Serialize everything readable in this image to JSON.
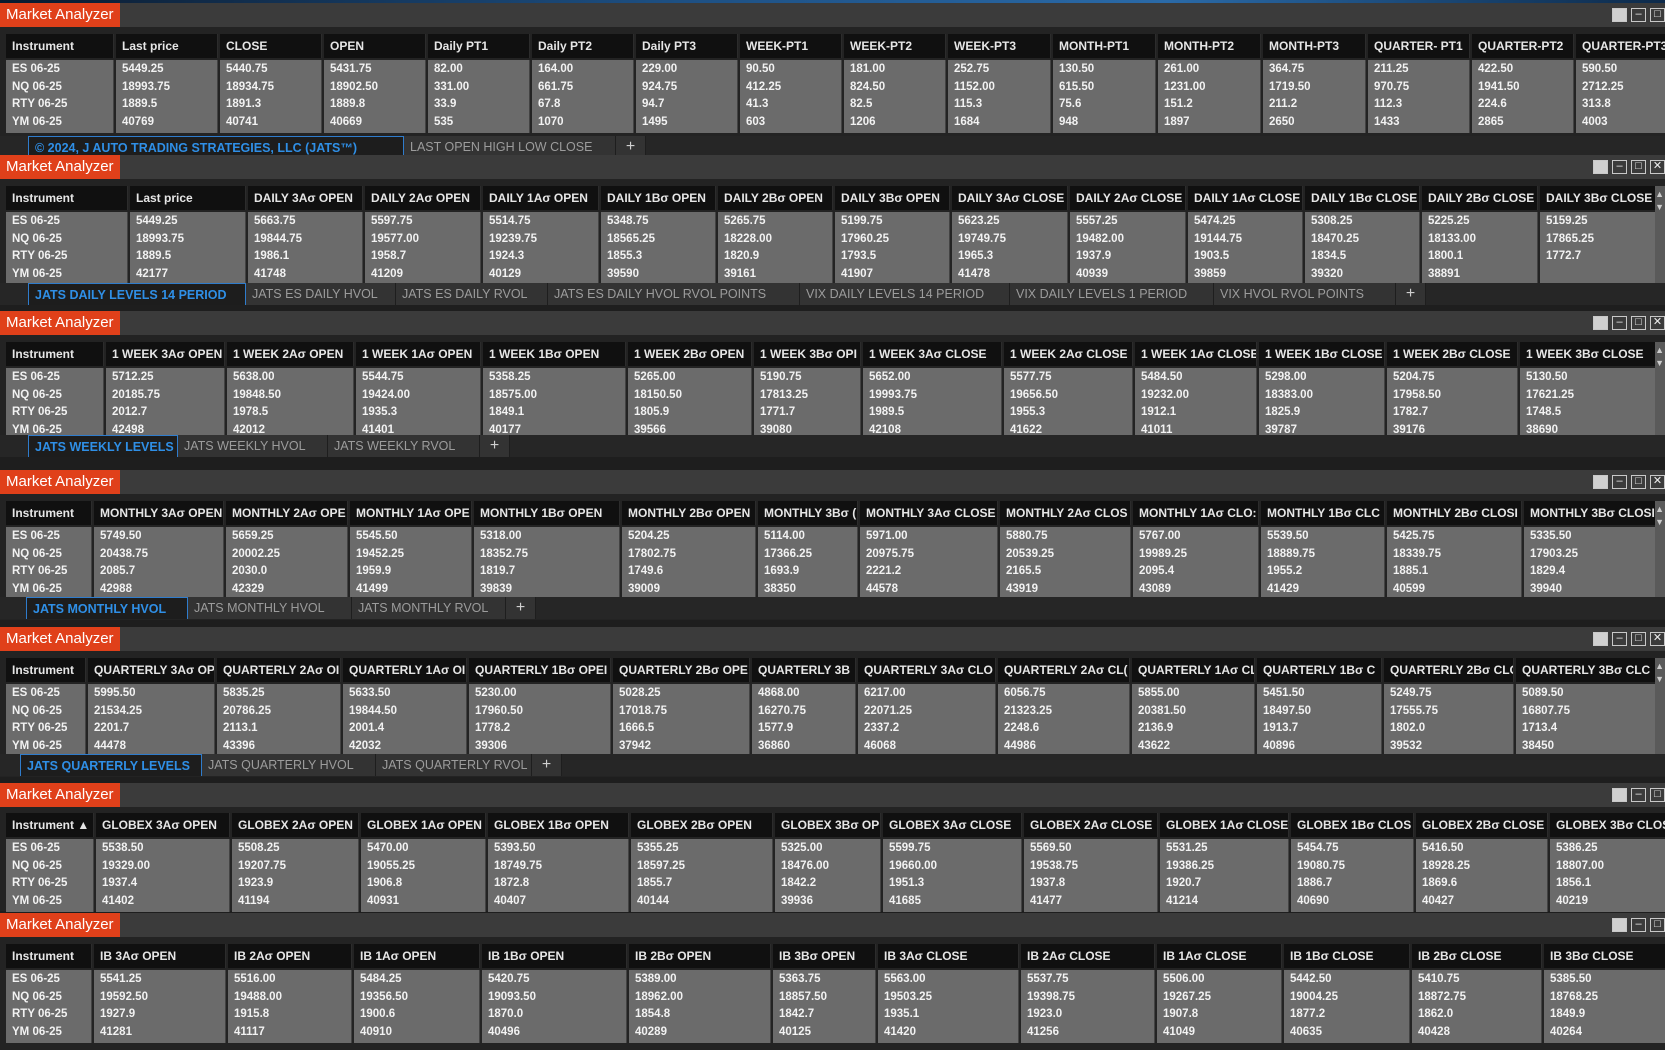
{
  "instruments": [
    "ES 06-25",
    "NQ 06-25",
    "RTY 06-25",
    "YM 06-25"
  ],
  "panels": [
    {
      "title": "Market Analyzer",
      "columns": [
        "Instrument",
        "Last price",
        "CLOSE",
        "OPEN",
        "Daily PT1",
        "Daily PT2",
        "Daily PT3",
        "WEEK-PT1",
        "WEEK-PT2",
        "WEEK-PT3",
        "MONTH-PT1",
        "MONTH-PT2",
        "MONTH-PT3",
        "QUARTER- PT1",
        "QUARTER-PT2",
        "QUARTER-PT3"
      ],
      "rows": [
        [
          "ES 06-25",
          "5449.25",
          "5440.75",
          "5431.75",
          "82.00",
          "164.00",
          "229.00",
          "90.50",
          "181.00",
          "252.75",
          "130.50",
          "261.00",
          "364.75",
          "211.25",
          "422.50",
          "590.50"
        ],
        [
          "NQ 06-25",
          "18993.75",
          "18934.75",
          "18902.50",
          "331.00",
          "661.75",
          "924.75",
          "412.25",
          "824.50",
          "1152.00",
          "615.50",
          "1231.00",
          "1719.50",
          "970.75",
          "1941.50",
          "2712.25"
        ],
        [
          "RTY 06-25",
          "1889.5",
          "1891.3",
          "1889.8",
          "33.9",
          "67.8",
          "94.7",
          "41.3",
          "82.5",
          "115.3",
          "75.6",
          "151.2",
          "211.2",
          "112.3",
          "224.6",
          "313.8"
        ],
        [
          "YM 06-25",
          "40769",
          "40741",
          "40669",
          "535",
          "1070",
          "1495",
          "603",
          "1206",
          "1684",
          "948",
          "1897",
          "2650",
          "1433",
          "2865",
          "4003"
        ]
      ],
      "tabs": [
        "© 2024, J AUTO TRADING STRATEGIES, LLC (JATS™)",
        "LAST OPEN HIGH LOW CLOSE",
        "+"
      ]
    },
    {
      "title": "Market Analyzer",
      "columns": [
        "Instrument",
        "Last price",
        "DAILY 3Aσ OPEN",
        "DAILY 2Aσ OPEN",
        "DAILY 1Aσ OPEN",
        "DAILY 1Bσ OPEN",
        "DAILY 2Bσ OPEN",
        "DAILY 3Bσ OPEN",
        "DAILY 3Aσ CLOSE",
        "DAILY 2Aσ CLOSE",
        "DAILY 1Aσ CLOSE",
        "DAILY 1Bσ CLOSE",
        "DAILY 2Bσ CLOSE",
        "DAILY 3Bσ CLOSE"
      ],
      "rows": [
        [
          "ES 06-25",
          "5449.25",
          "5663.75",
          "5597.75",
          "5514.75",
          "5348.75",
          "5265.75",
          "5199.75",
          "5623.25",
          "5557.25",
          "5474.25",
          "5308.25",
          "5225.25",
          "5159.25"
        ],
        [
          "NQ 06-25",
          "18993.75",
          "19844.75",
          "19577.00",
          "19239.75",
          "18565.25",
          "18228.00",
          "17960.25",
          "19749.75",
          "19482.00",
          "19144.75",
          "18470.25",
          "18133.00",
          "17865.25"
        ],
        [
          "RTY 06-25",
          "1889.5",
          "1986.1",
          "1958.7",
          "1924.3",
          "1855.3",
          "1820.9",
          "1793.5",
          "1965.3",
          "1937.9",
          "1903.5",
          "1834.5",
          "1800.1",
          "1772.7"
        ],
        [
          "YM 06-25",
          "42177",
          "41748",
          "41209",
          "40129",
          "39590",
          "39161",
          "41907",
          "41478",
          "40939",
          "39859",
          "39320",
          "38891"
        ]
      ],
      "tabs": [
        "JATS DAILY LEVELS 14 PERIOD",
        "JATS ES DAILY HVOL",
        "JATS ES DAILY RVOL",
        "JATS ES DAILY HVOL RVOL POINTS",
        "VIX DAILY LEVELS 14 PERIOD",
        "VIX DAILY LEVELS 1 PERIOD",
        "VIX HVOL RVOL POINTS",
        "+"
      ]
    },
    {
      "title": "Market Analyzer",
      "columns": [
        "Instrument",
        "1 WEEK 3Aσ OPEN",
        "1 WEEK 2Aσ OPEN",
        "1 WEEK 1Aσ OPEN",
        "1 WEEK 1Bσ OPEN",
        "1 WEEK 2Bσ OPEN",
        "1 WEEK 3Bσ OPI",
        "1 WEEK 3Aσ CLOSE",
        "1 WEEK 2Aσ CLOSE",
        "1 WEEK 1Aσ CLOSE",
        "1 WEEK 1Bσ CLOSE",
        "1 WEEK 2Bσ CLOSE",
        "1 WEEK 3Bσ CLOSE"
      ],
      "rows": [
        [
          "ES 06-25",
          "5712.25",
          "5638.00",
          "5544.75",
          "5358.25",
          "5265.00",
          "5190.75",
          "5652.00",
          "5577.75",
          "5484.50",
          "5298.00",
          "5204.75",
          "5130.50"
        ],
        [
          "NQ 06-25",
          "20185.75",
          "19848.50",
          "19424.00",
          "18575.00",
          "18150.50",
          "17813.25",
          "19993.75",
          "19656.50",
          "19232.00",
          "18383.00",
          "17958.50",
          "17621.25"
        ],
        [
          "RTY 06-25",
          "2012.7",
          "1978.5",
          "1935.3",
          "1849.1",
          "1805.9",
          "1771.7",
          "1989.5",
          "1955.3",
          "1912.1",
          "1825.9",
          "1782.7",
          "1748.5"
        ],
        [
          "YM 06-25",
          "42498",
          "42012",
          "41401",
          "40177",
          "39566",
          "39080",
          "42108",
          "41622",
          "41011",
          "39787",
          "39176",
          "38690"
        ]
      ],
      "tabs": [
        "JATS WEEKLY LEVELS",
        "JATS WEEKLY HVOL",
        "JATS WEEKLY RVOL",
        "+"
      ]
    },
    {
      "title": "Market Analyzer",
      "columns": [
        "Instrument",
        "MONTHLY 3Aσ OPEN",
        "MONTHLY 2Aσ OPE",
        "MONTHLY 1Aσ OPE",
        "MONTHLY 1Bσ OPEN",
        "MONTHLY 2Bσ OPEN",
        "MONTHLY 3Bσ (",
        "MONTHLY 3Aσ CLOSE",
        "MONTHLY 2Aσ CLOS",
        "MONTHLY 1Aσ CLO:",
        "MONTHLY 1Bσ CLC",
        "MONTHLY 2Bσ CLOSI",
        "MONTHLY 3Bσ CLOSI"
      ],
      "rows": [
        [
          "ES 06-25",
          "5749.50",
          "5659.25",
          "5545.50",
          "5318.00",
          "5204.25",
          "5114.00",
          "5971.00",
          "5880.75",
          "5767.00",
          "5539.50",
          "5425.75",
          "5335.50"
        ],
        [
          "NQ 06-25",
          "20438.75",
          "20002.25",
          "19452.25",
          "18352.75",
          "17802.75",
          "17366.25",
          "20975.75",
          "20539.25",
          "19989.25",
          "18889.75",
          "18339.75",
          "17903.25"
        ],
        [
          "RTY 06-25",
          "2085.7",
          "2030.0",
          "1959.9",
          "1819.7",
          "1749.6",
          "1693.9",
          "2221.2",
          "2165.5",
          "2095.4",
          "1955.2",
          "1885.1",
          "1829.4"
        ],
        [
          "YM 06-25",
          "42988",
          "42329",
          "41499",
          "39839",
          "39009",
          "38350",
          "44578",
          "43919",
          "43089",
          "41429",
          "40599",
          "39940"
        ]
      ],
      "tabs": [
        "JATS MONTHLY HVOL",
        "JATS MONTHLY HVOL",
        "JATS MONTHLY RVOL",
        "+"
      ]
    },
    {
      "title": "Market Analyzer",
      "columns": [
        "Instrument",
        "QUARTERLY 3Aσ OP",
        "QUARTERLY 2Aσ OI",
        "QUARTERLY 1Aσ OI",
        "QUARTERLY 1Bσ OPEI",
        "QUARTERLY 2Bσ OPE",
        "QUARTERLY 3B",
        "QUARTERLY 3Aσ CLO",
        "QUARTERLY 2Aσ CL(",
        "QUARTERLY 1Aσ CL",
        "QUARTERLY 1Bσ C",
        "QUARTERLY 2Bσ CLC",
        "QUARTERLY 3Bσ CLC"
      ],
      "rows": [
        [
          "ES 06-25",
          "5995.50",
          "5835.25",
          "5633.50",
          "5230.00",
          "5028.25",
          "4868.00",
          "6217.00",
          "6056.75",
          "5855.00",
          "5451.50",
          "5249.75",
          "5089.50"
        ],
        [
          "NQ 06-25",
          "21534.25",
          "20786.25",
          "19844.50",
          "17960.50",
          "17018.75",
          "16270.75",
          "22071.25",
          "21323.25",
          "20381.50",
          "18497.50",
          "17555.75",
          "16807.75"
        ],
        [
          "RTY 06-25",
          "2201.7",
          "2113.1",
          "2001.4",
          "1778.2",
          "1666.5",
          "1577.9",
          "2337.2",
          "2248.6",
          "2136.9",
          "1913.7",
          "1802.0",
          "1713.4"
        ],
        [
          "YM 06-25",
          "44478",
          "43396",
          "42032",
          "39306",
          "37942",
          "36860",
          "46068",
          "44986",
          "43622",
          "40896",
          "39532",
          "38450"
        ]
      ],
      "tabs": [
        "JATS QUARTERLY LEVELS",
        "JATS QUARTERLY HVOL",
        "JATS QUARTERLY RVOL",
        "+"
      ]
    },
    {
      "title": "Market Analyzer",
      "columns": [
        "Instrument ▲",
        "GLOBEX 3Aσ OPEN",
        "GLOBEX 2Aσ OPEN",
        "GLOBEX 1Aσ OPEN",
        "GLOBEX 1Bσ OPEN",
        "GLOBEX 2Bσ OPEN",
        "GLOBEX 3Bσ OP",
        "GLOBEX 3Aσ CLOSE",
        "GLOBEX 2Aσ CLOSE",
        "GLOBEX 1Aσ CLOSE",
        "GLOBEX 1Bσ CLOS",
        "GLOBEX 2Bσ CLOSE",
        "GLOBEX 3Bσ CLOS"
      ],
      "rows": [
        [
          "ES 06-25",
          "5538.50",
          "5508.25",
          "5470.00",
          "5393.50",
          "5355.25",
          "5325.00",
          "5599.75",
          "5569.50",
          "5531.25",
          "5454.75",
          "5416.50",
          "5386.25"
        ],
        [
          "NQ 06-25",
          "19329.00",
          "19207.75",
          "19055.25",
          "18749.75",
          "18597.25",
          "18476.00",
          "19660.00",
          "19538.75",
          "19386.25",
          "19080.75",
          "18928.25",
          "18807.00"
        ],
        [
          "RTY 06-25",
          "1937.4",
          "1923.9",
          "1906.8",
          "1872.8",
          "1855.7",
          "1842.2",
          "1951.3",
          "1937.8",
          "1920.7",
          "1886.7",
          "1869.6",
          "1856.1"
        ],
        [
          "YM 06-25",
          "41402",
          "41194",
          "40931",
          "40407",
          "40144",
          "39936",
          "41685",
          "41477",
          "41214",
          "40690",
          "40427",
          "40219"
        ]
      ],
      "tabs": []
    },
    {
      "title": "Market Analyzer",
      "columns": [
        "Instrument",
        "IB 3Aσ OPEN",
        "IB 2Aσ OPEN",
        "IB 1Aσ OPEN",
        "IB 1Bσ OPEN",
        "IB 2Bσ OPEN",
        "IB 3Bσ OPEN",
        "IB 3Aσ CLOSE",
        "IB 2Aσ CLOSE",
        "IB 1Aσ CLOSE",
        "IB 1Bσ CLOSE",
        "IB 2Bσ CLOSE",
        "IB 3Bσ CLOSE"
      ],
      "rows": [
        [
          "ES 06-25",
          "5541.25",
          "5516.00",
          "5484.25",
          "5420.75",
          "5389.00",
          "5363.75",
          "5563.00",
          "5537.75",
          "5506.00",
          "5442.50",
          "5410.75",
          "5385.50"
        ],
        [
          "NQ 06-25",
          "19592.50",
          "19488.00",
          "19356.50",
          "19093.50",
          "18962.00",
          "18857.50",
          "19503.25",
          "19398.75",
          "19267.25",
          "19004.25",
          "18872.75",
          "18768.25"
        ],
        [
          "RTY 06-25",
          "1927.9",
          "1915.8",
          "1900.6",
          "1870.0",
          "1854.8",
          "1842.7",
          "1935.1",
          "1923.0",
          "1907.8",
          "1877.2",
          "1862.0",
          "1849.9"
        ],
        [
          "YM 06-25",
          "41281",
          "41117",
          "40910",
          "40496",
          "40289",
          "40125",
          "41420",
          "41256",
          "41049",
          "40635",
          "40428",
          "40264"
        ]
      ],
      "tabs": []
    }
  ]
}
